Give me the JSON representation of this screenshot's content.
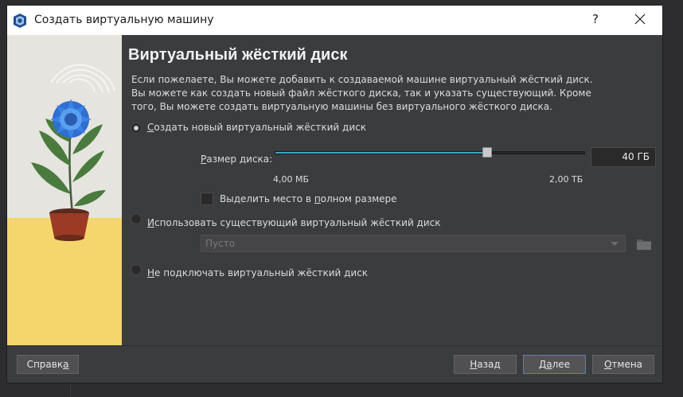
{
  "window": {
    "title": "Создать виртуальную машину",
    "help_label": "?",
    "icon": "virtualbox-icon"
  },
  "page": {
    "heading": "Виртуальный жёсткий диск",
    "description": "Если пожелаете, Вы можете добавить к создаваемой машине виртуальный жёсткий диск. Вы можете как создать новый файл жёсткого диска, так и указать существующий. Кроме того, Вы можете создать виртуальную машины без виртуального жёсткого диска."
  },
  "options": {
    "create_new": {
      "label_prefix": "",
      "label_mnemonic": "С",
      "label_rest": "оздать новый виртуальный жёсткий диск",
      "checked": true
    },
    "use_existing": {
      "label_prefix": "",
      "label_mnemonic": "И",
      "label_rest": "спользовать существующий виртуальный жёсткий диск",
      "checked": false
    },
    "no_disk": {
      "label_prefix": "",
      "label_mnemonic": "Н",
      "label_rest": "е подключать виртуальный жёсткий диск",
      "checked": false
    }
  },
  "disk_size": {
    "label_mnemonic": "Р",
    "label_rest": "азмер диска:",
    "value": "40 ГБ",
    "slider_fraction": 0.69,
    "min_label": "4,00 МБ",
    "max_label": "2,00 ТБ",
    "preallocate_label_prefix": "Выделить место в ",
    "preallocate_mnemonic": "п",
    "preallocate_label_rest": "олном размере",
    "preallocate_checked": false
  },
  "existing_disk": {
    "selected": "Пусто",
    "browse_icon": "folder-icon"
  },
  "buttons": {
    "help_prefix": "Справк",
    "help_mnemonic": "а",
    "help_rest": "",
    "back_mnemonic": "Н",
    "back_rest": "азад",
    "next_prefix": "Д",
    "next_mnemonic": "а",
    "next_rest": "лее",
    "cancel_mnemonic": "О",
    "cancel_rest": "тмена"
  },
  "colors": {
    "accent": "#3ea6bf",
    "dialog_bg": "#3b3c3e",
    "titlebar_bg": "#ffffff"
  }
}
